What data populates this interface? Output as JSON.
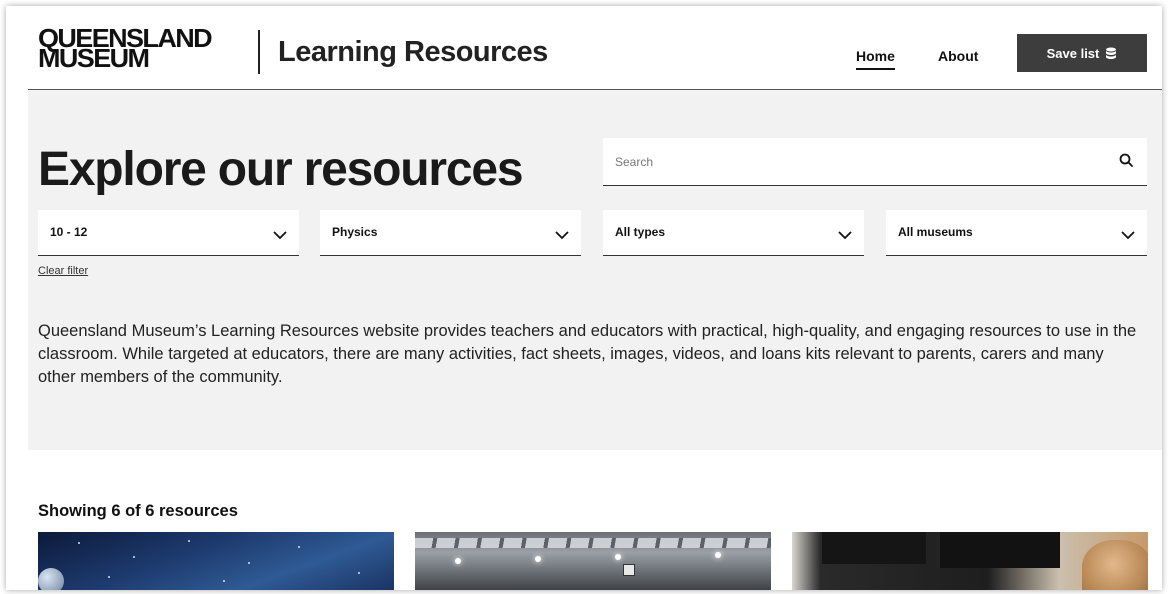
{
  "header": {
    "logo_line1": "QUEENSLAND",
    "logo_line2": "MUSEUM",
    "site_title": "Learning Resources",
    "nav": {
      "home": "Home",
      "about": "About"
    },
    "save_list_label": "Save list"
  },
  "explore": {
    "title": "Explore our resources",
    "search_placeholder": "Search",
    "filters": [
      {
        "label": "10 - 12"
      },
      {
        "label": "Physics"
      },
      {
        "label": "All types"
      },
      {
        "label": "All museums"
      }
    ],
    "clear_filter": "Clear filter",
    "intro": "Queensland Museum’s Learning Resources website provides teachers and educators with practical, high-quality, and engaging resources to use in the classroom. While targeted at educators, there are many activities, fact sheets, images, videos, and loans kits relevant to parents, carers and many other members of the community."
  },
  "results": {
    "showing": "Showing 6 of 6 resources"
  },
  "colors": {
    "panel_bg": "#f2f2f2",
    "button_bg": "#3d3d3d",
    "text": "#1a1a1a"
  },
  "icons": {
    "search": "search-icon",
    "chevron": "chevron-down-icon",
    "save": "database-icon"
  }
}
